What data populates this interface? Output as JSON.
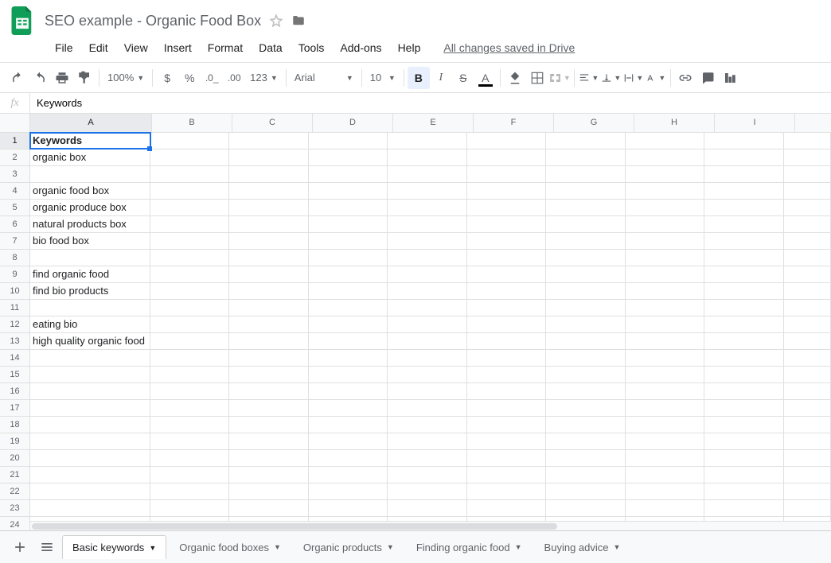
{
  "doc_title": "SEO example - Organic Food Box",
  "save_status": "All changes saved in Drive",
  "menubar": [
    "File",
    "Edit",
    "View",
    "Insert",
    "Format",
    "Data",
    "Tools",
    "Add-ons",
    "Help"
  ],
  "toolbar": {
    "zoom": "100%",
    "font": "Arial",
    "font_size": "10",
    "number_format": "123"
  },
  "formula_bar_value": "Keywords",
  "columns": [
    "A",
    "B",
    "C",
    "D",
    "E",
    "F",
    "G",
    "H",
    "I"
  ],
  "rows": 24,
  "active_cell": {
    "row": 1,
    "col": "A"
  },
  "cells": {
    "1": {
      "A": {
        "v": "Keywords",
        "bold": true
      }
    },
    "2": {
      "A": {
        "v": "organic box"
      }
    },
    "4": {
      "A": {
        "v": "organic food box"
      }
    },
    "5": {
      "A": {
        "v": "organic produce box"
      }
    },
    "6": {
      "A": {
        "v": "natural products box"
      }
    },
    "7": {
      "A": {
        "v": "bio food box"
      }
    },
    "9": {
      "A": {
        "v": "find organic food"
      }
    },
    "10": {
      "A": {
        "v": "find bio products"
      }
    },
    "12": {
      "A": {
        "v": "eating bio"
      }
    },
    "13": {
      "A": {
        "v": "high quality organic food"
      }
    }
  },
  "sheet_tabs": [
    {
      "name": "Basic keywords",
      "active": true
    },
    {
      "name": "Organic food boxes"
    },
    {
      "name": "Organic products"
    },
    {
      "name": "Finding organic food"
    },
    {
      "name": "Buying advice"
    }
  ]
}
